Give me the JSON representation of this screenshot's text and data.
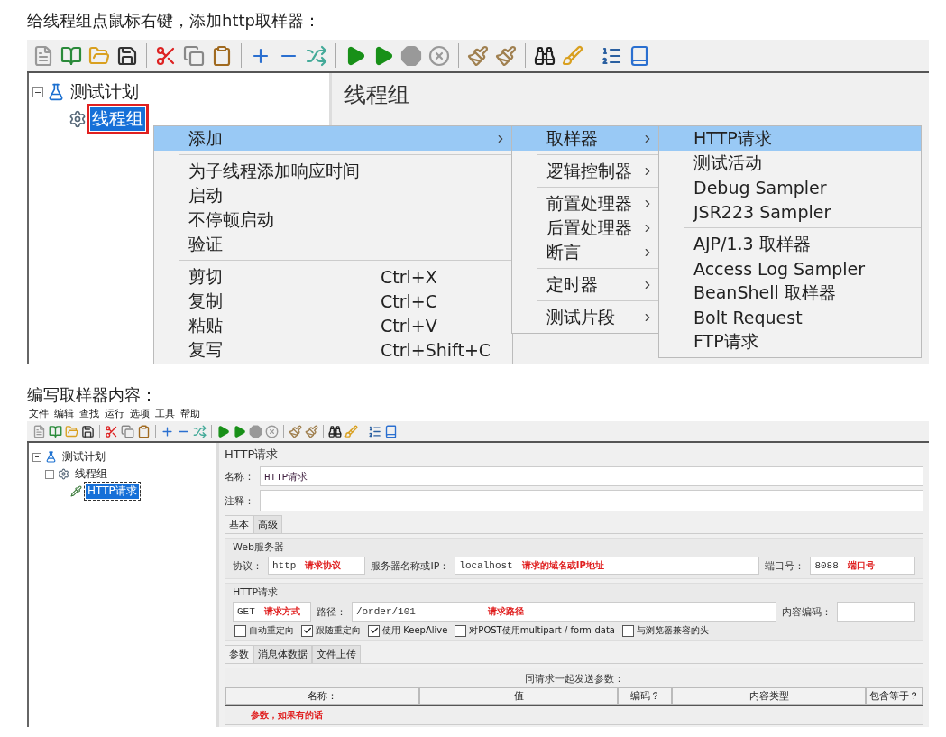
{
  "heading_1": "给线程组点鼠标右键，添加http取样器：",
  "screenshot_1": {
    "tree": [
      {
        "label": "测试计划",
        "kind": "plan",
        "selected": false,
        "marked": false,
        "expanded": true,
        "children": [
          {
            "label": "线程组",
            "kind": "thread_group",
            "selected": true,
            "marked": true
          }
        ]
      }
    ],
    "panel_title": "线程组",
    "menus": [
      {
        "items": [
          {
            "kind": "item",
            "label": "添加",
            "has_submenu": true,
            "selected": true
          },
          {
            "kind": "separator"
          },
          {
            "kind": "item",
            "label": "为子线程添加响应时间",
            "has_submenu": false,
            "selected": false
          },
          {
            "kind": "item",
            "label": "启动",
            "has_submenu": false,
            "selected": false
          },
          {
            "kind": "item",
            "label": "不停顿启动",
            "has_submenu": false,
            "selected": false
          },
          {
            "kind": "item",
            "label": "验证",
            "has_submenu": false,
            "selected": false
          },
          {
            "kind": "separator"
          },
          {
            "kind": "item",
            "label": "剪切",
            "shortcut": "Ctrl+X",
            "has_submenu": false,
            "selected": false
          },
          {
            "kind": "item",
            "label": "复制",
            "shortcut": "Ctrl+C",
            "has_submenu": false,
            "selected": false
          },
          {
            "kind": "item",
            "label": "粘贴",
            "shortcut": "Ctrl+V",
            "has_submenu": false,
            "selected": false
          },
          {
            "kind": "item",
            "label": "复写",
            "shortcut": "Ctrl+Shift+C",
            "has_submenu": false,
            "selected": false
          }
        ]
      },
      {
        "items": [
          {
            "kind": "item",
            "label": "取样器",
            "has_submenu": true,
            "selected": true
          },
          {
            "kind": "separator"
          },
          {
            "kind": "item",
            "label": "逻辑控制器",
            "has_submenu": true,
            "selected": false
          },
          {
            "kind": "separator"
          },
          {
            "kind": "item",
            "label": "前置处理器",
            "has_submenu": true,
            "selected": false
          },
          {
            "kind": "item",
            "label": "后置处理器",
            "has_submenu": true,
            "selected": false
          },
          {
            "kind": "item",
            "label": "断言",
            "has_submenu": true,
            "selected": false
          },
          {
            "kind": "separator"
          },
          {
            "kind": "item",
            "label": "定时器",
            "has_submenu": true,
            "selected": false
          },
          {
            "kind": "separator"
          },
          {
            "kind": "item",
            "label": "测试片段",
            "has_submenu": true,
            "selected": false
          }
        ]
      },
      {
        "items": [
          {
            "kind": "item",
            "label": "HTTP请求",
            "has_submenu": false,
            "selected": true
          },
          {
            "kind": "item",
            "label": "测试活动",
            "has_submenu": false,
            "selected": false
          },
          {
            "kind": "item",
            "label": "Debug Sampler",
            "has_submenu": false,
            "selected": false
          },
          {
            "kind": "item",
            "label": "JSR223 Sampler",
            "has_submenu": false,
            "selected": false
          },
          {
            "kind": "separator"
          },
          {
            "kind": "item",
            "label": "AJP/1.3 取样器",
            "has_submenu": false,
            "selected": false
          },
          {
            "kind": "item",
            "label": "Access Log Sampler",
            "has_submenu": false,
            "selected": false
          },
          {
            "kind": "item",
            "label": "BeanShell 取样器",
            "has_submenu": false,
            "selected": false
          },
          {
            "kind": "item",
            "label": "Bolt Request",
            "has_submenu": false,
            "selected": false
          },
          {
            "kind": "item",
            "label": "FTP请求",
            "has_submenu": false,
            "selected": false
          }
        ]
      }
    ]
  },
  "heading_2": "编写取样器内容：",
  "screenshot_2": {
    "menu_bar": [
      "文件",
      "编辑",
      "查找",
      "运行",
      "选项",
      "工具",
      "帮助"
    ],
    "tree": [
      {
        "label": "测试计划",
        "kind": "plan",
        "selected": false,
        "marked": false,
        "expanded": true,
        "children": [
          {
            "label": "线程组",
            "kind": "thread_group",
            "selected": false,
            "marked": false,
            "expanded": true,
            "children": [
              {
                "label": "HTTP请求",
                "kind": "sampler",
                "selected": true,
                "marked": false
              }
            ]
          }
        ]
      }
    ],
    "panel": {
      "title": "HTTP请求",
      "name_label": "名称：",
      "name_value": "HTTP请求",
      "comment_label": "注释：",
      "tabs": [
        {
          "label": "基本",
          "selected": true
        },
        {
          "label": "高级",
          "selected": false
        }
      ],
      "web_server": {
        "legend": "Web服务器",
        "fields": [
          {
            "label": "协议：",
            "value": "http",
            "annotation": "请求协议"
          },
          {
            "label": "服务器名称或IP：",
            "value": "localhost",
            "annotation": "请求的域名或IP地址"
          },
          {
            "label": "端口号：",
            "value": "8088",
            "annotation": "端口号"
          }
        ]
      },
      "http_request": {
        "legend": "HTTP请求",
        "method": {
          "value": "GET",
          "annotation": "请求方式"
        },
        "path": {
          "label": "路径：",
          "value": "/order/101",
          "annotation": "请求路径"
        },
        "encoding_label": "内容编码：",
        "options": [
          {
            "label": "自动重定向",
            "checked": false
          },
          {
            "label": "跟随重定向",
            "checked": true
          },
          {
            "label": "使用 KeepAlive",
            "checked": true
          },
          {
            "label": "对POST使用multipart / form-data",
            "checked": false
          },
          {
            "label": "与浏览器兼容的头",
            "checked": false
          }
        ]
      },
      "sub_tabs": [
        {
          "label": "参数",
          "selected": true
        },
        {
          "label": "消息体数据",
          "selected": false
        },
        {
          "label": "文件上传",
          "selected": false
        }
      ],
      "params_table": {
        "caption": "同请求一起发送参数：",
        "columns": [
          "名称：",
          "值",
          "编码？",
          "内容类型",
          "包含等于？"
        ],
        "annotation": "参数，如果有的话"
      }
    }
  }
}
